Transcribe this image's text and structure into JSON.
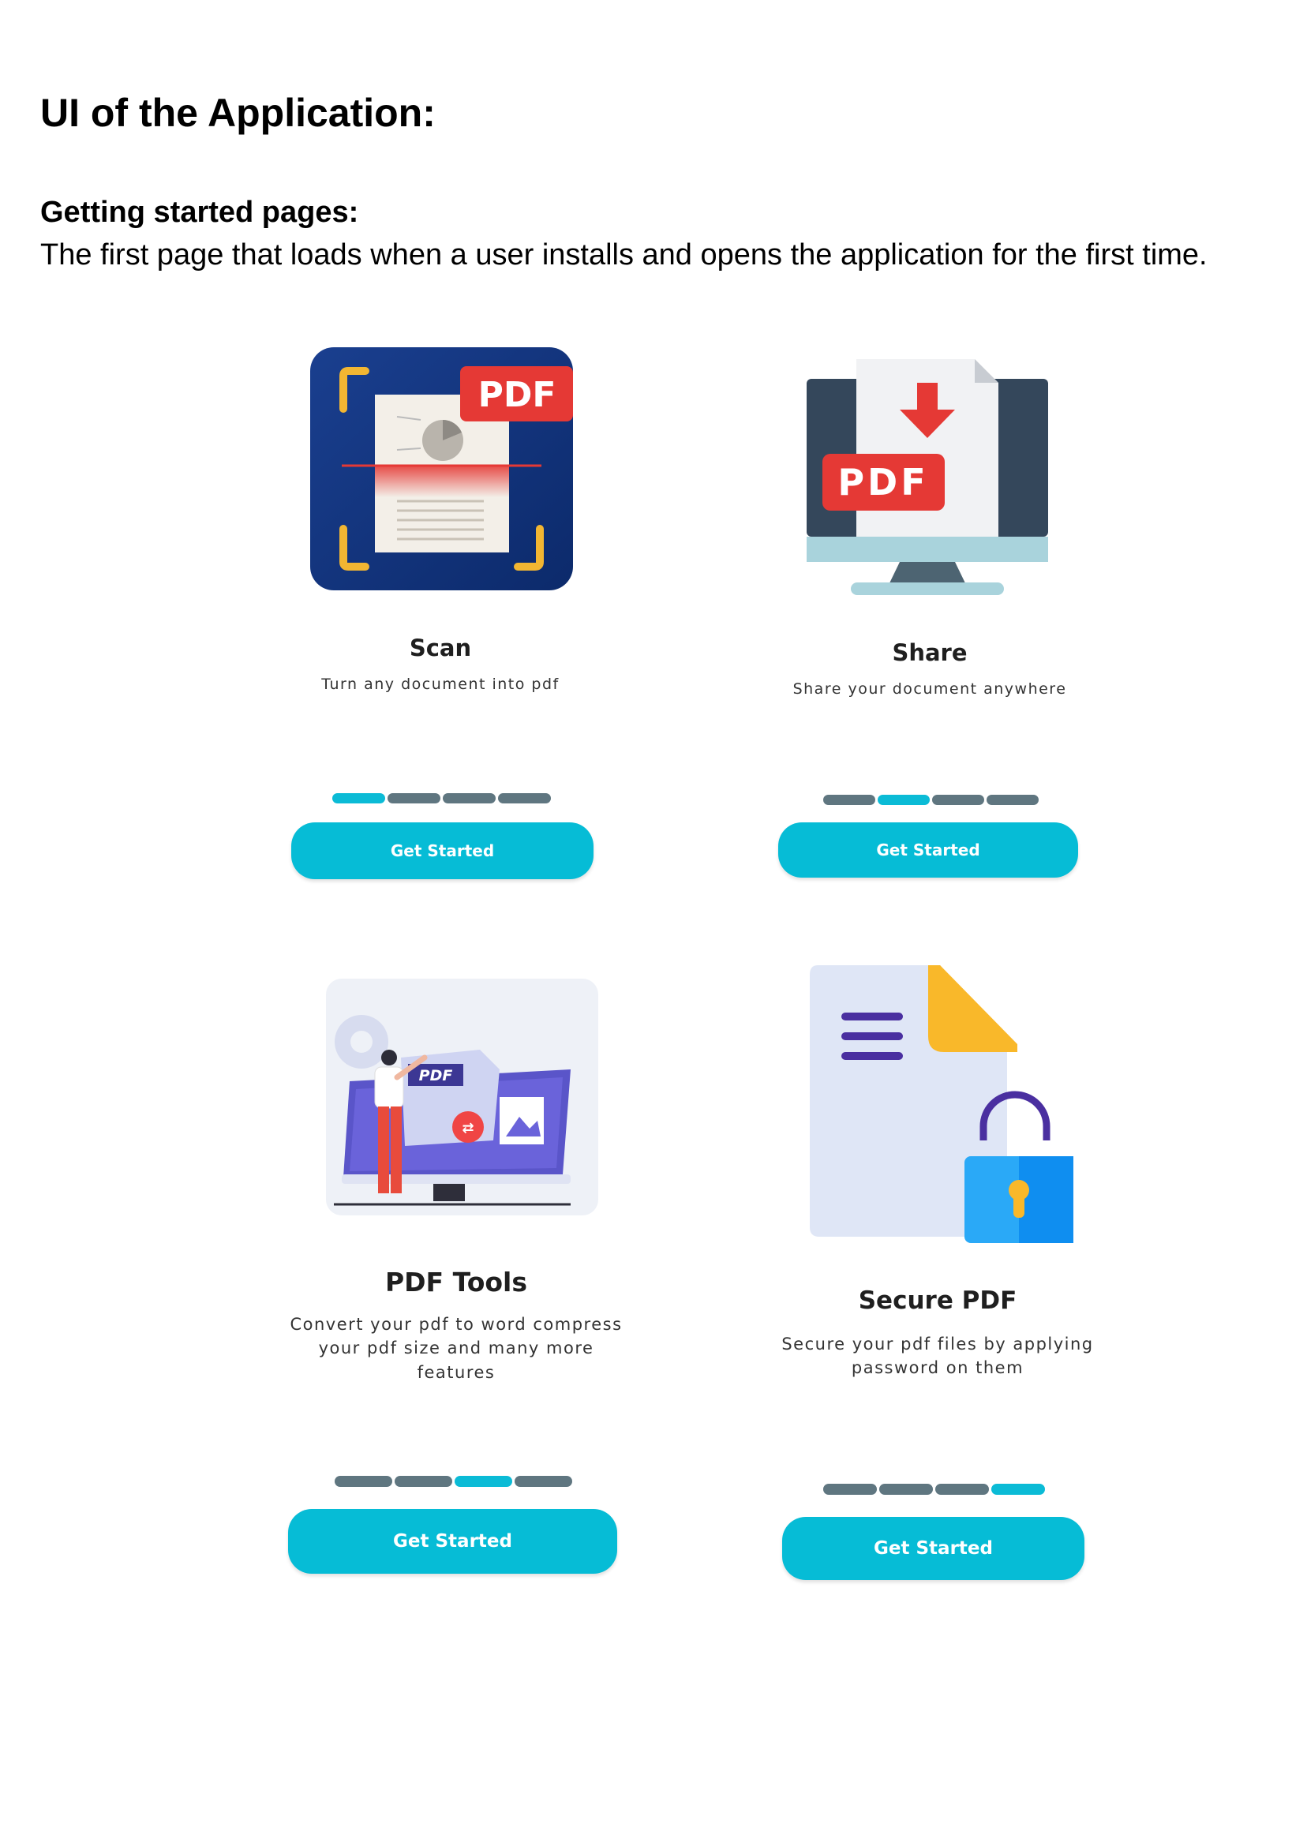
{
  "doc_title": "UI of the Application:",
  "section": {
    "title": "Getting started pages:",
    "description": "The first page that loads when a user installs and opens the application for the first time."
  },
  "screens": [
    {
      "title": "Scan",
      "subtitle": "Turn any document into pdf",
      "button": "Get Started",
      "page_index": 1,
      "page_total": 4,
      "badge": "PDF"
    },
    {
      "title": "Share",
      "subtitle": "Share your document anywhere",
      "button": "Get Started",
      "page_index": 2,
      "page_total": 4,
      "badge": "PDF"
    },
    {
      "title": "PDF Tools",
      "subtitle_lines": [
        "Convert your pdf to word compress",
        "your pdf size and many more",
        "features"
      ],
      "button": "Get Started",
      "page_index": 3,
      "page_total": 4,
      "badge": "PDF"
    },
    {
      "title": "Secure PDF",
      "subtitle_lines": [
        "Secure your pdf files by applying",
        "password on them"
      ],
      "button": "Get Started",
      "page_index": 4,
      "page_total": 4
    }
  ],
  "colors": {
    "accent": "#06bcd6",
    "inactive_dot": "#5f7680",
    "pdf_red": "#e53935"
  },
  "icons": [
    "scan-document-icon",
    "monitor-download-icon",
    "pdf-tools-illustration",
    "secure-file-lock-icon"
  ]
}
